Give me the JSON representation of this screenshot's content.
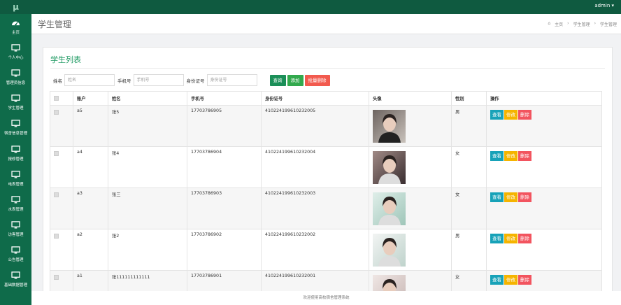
{
  "app": {
    "logo": "μ",
    "user": "admin ▾"
  },
  "sidebar": {
    "items": [
      {
        "label": "主页",
        "icon": "dashboard-icon"
      },
      {
        "label": "个人中心",
        "icon": "monitor-icon"
      },
      {
        "label": "管理员信息",
        "icon": "monitor-icon"
      },
      {
        "label": "学生管理",
        "icon": "monitor-icon"
      },
      {
        "label": "宿舍信息管理",
        "icon": "monitor-icon"
      },
      {
        "label": "报修管理",
        "icon": "monitor-icon"
      },
      {
        "label": "电表管理",
        "icon": "monitor-icon"
      },
      {
        "label": "水表管理",
        "icon": "monitor-icon"
      },
      {
        "label": "访客管理",
        "icon": "monitor-icon"
      },
      {
        "label": "公告管理",
        "icon": "monitor-icon"
      },
      {
        "label": "基础数据管理",
        "icon": "monitor-icon"
      }
    ]
  },
  "header": {
    "title": "学生管理",
    "breadcrumb": [
      "主页",
      "学生管理",
      "学生管理"
    ]
  },
  "card": {
    "title": "学生列表"
  },
  "filters": {
    "name_label": "姓名",
    "name_placeholder": "姓名",
    "phone_label": "手机号",
    "phone_placeholder": "手机号",
    "id_label": "身份证号",
    "id_placeholder": "身份证号",
    "query": "查询",
    "add": "添加",
    "batch_delete": "批量删除"
  },
  "table": {
    "headers": [
      "",
      "账户",
      "姓名",
      "手机号",
      "身份证号",
      "头像",
      "性别",
      "操作"
    ],
    "rows": [
      {
        "account": "a5",
        "name": "张5",
        "phone": "17703786905",
        "idno": "410224199610232005",
        "gender": "男"
      },
      {
        "account": "a4",
        "name": "张4",
        "phone": "17703786904",
        "idno": "410224199610232004",
        "gender": "女"
      },
      {
        "account": "a3",
        "name": "张三",
        "phone": "17703786903",
        "idno": "410224199610232003",
        "gender": "女"
      },
      {
        "account": "a2",
        "name": "张2",
        "phone": "17703786902",
        "idno": "410224199610232002",
        "gender": "男"
      },
      {
        "account": "a1",
        "name": "张111111111111",
        "phone": "17703786901",
        "idno": "410224199610232001",
        "gender": "女"
      }
    ],
    "actions": {
      "view": "查看",
      "edit": "修改",
      "delete": "删除"
    }
  },
  "footer": "欢迎使用高校宿舍管理系统",
  "colors": {
    "topbar": "#0f5a40",
    "sidebar": "#0f6b4a",
    "title_green": "#1e9a62"
  }
}
